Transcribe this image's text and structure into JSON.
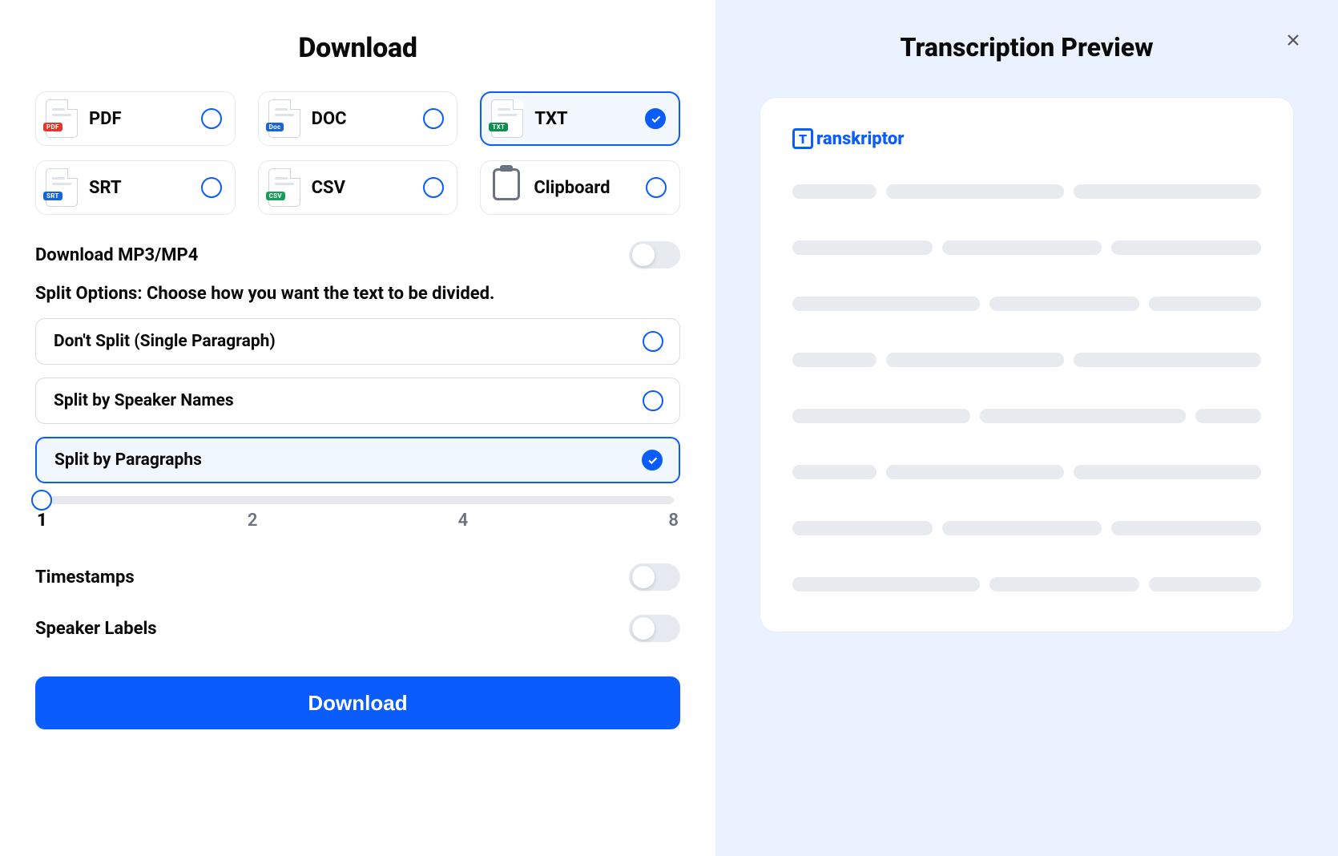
{
  "title": "Download",
  "formats": [
    {
      "id": "pdf",
      "label": "PDF",
      "badge": "PDF",
      "badgeClass": "badge-pdf",
      "selected": false
    },
    {
      "id": "doc",
      "label": "DOC",
      "badge": "Doc",
      "badgeClass": "badge-doc",
      "selected": false
    },
    {
      "id": "txt",
      "label": "TXT",
      "badge": "TXT",
      "badgeClass": "badge-txt",
      "selected": true
    },
    {
      "id": "srt",
      "label": "SRT",
      "badge": "SRT",
      "badgeClass": "badge-srt",
      "selected": false
    },
    {
      "id": "csv",
      "label": "CSV",
      "badge": "CSV",
      "badgeClass": "badge-csv",
      "selected": false
    },
    {
      "id": "clipboard",
      "label": "Clipboard",
      "badge": null,
      "badgeClass": null,
      "selected": false
    }
  ],
  "download_media": {
    "label": "Download MP3/MP4",
    "value": false
  },
  "split_options": {
    "title": "Split Options: Choose how you want the text to be divided.",
    "options": [
      {
        "id": "none",
        "label": "Don't Split (Single Paragraph)",
        "selected": false
      },
      {
        "id": "speaker",
        "label": "Split by Speaker Names",
        "selected": false
      },
      {
        "id": "para",
        "label": "Split by Paragraphs",
        "selected": true
      }
    ]
  },
  "slider": {
    "min": 1,
    "ticks": [
      "1",
      "2",
      "4",
      "8"
    ],
    "value": 1
  },
  "timestamps": {
    "label": "Timestamps",
    "value": false
  },
  "speaker_labels": {
    "label": "Speaker Labels",
    "value": false
  },
  "download_button": "Download",
  "preview": {
    "title": "Transcription Preview",
    "brand": "ranskriptor",
    "brand_initial": "T"
  }
}
